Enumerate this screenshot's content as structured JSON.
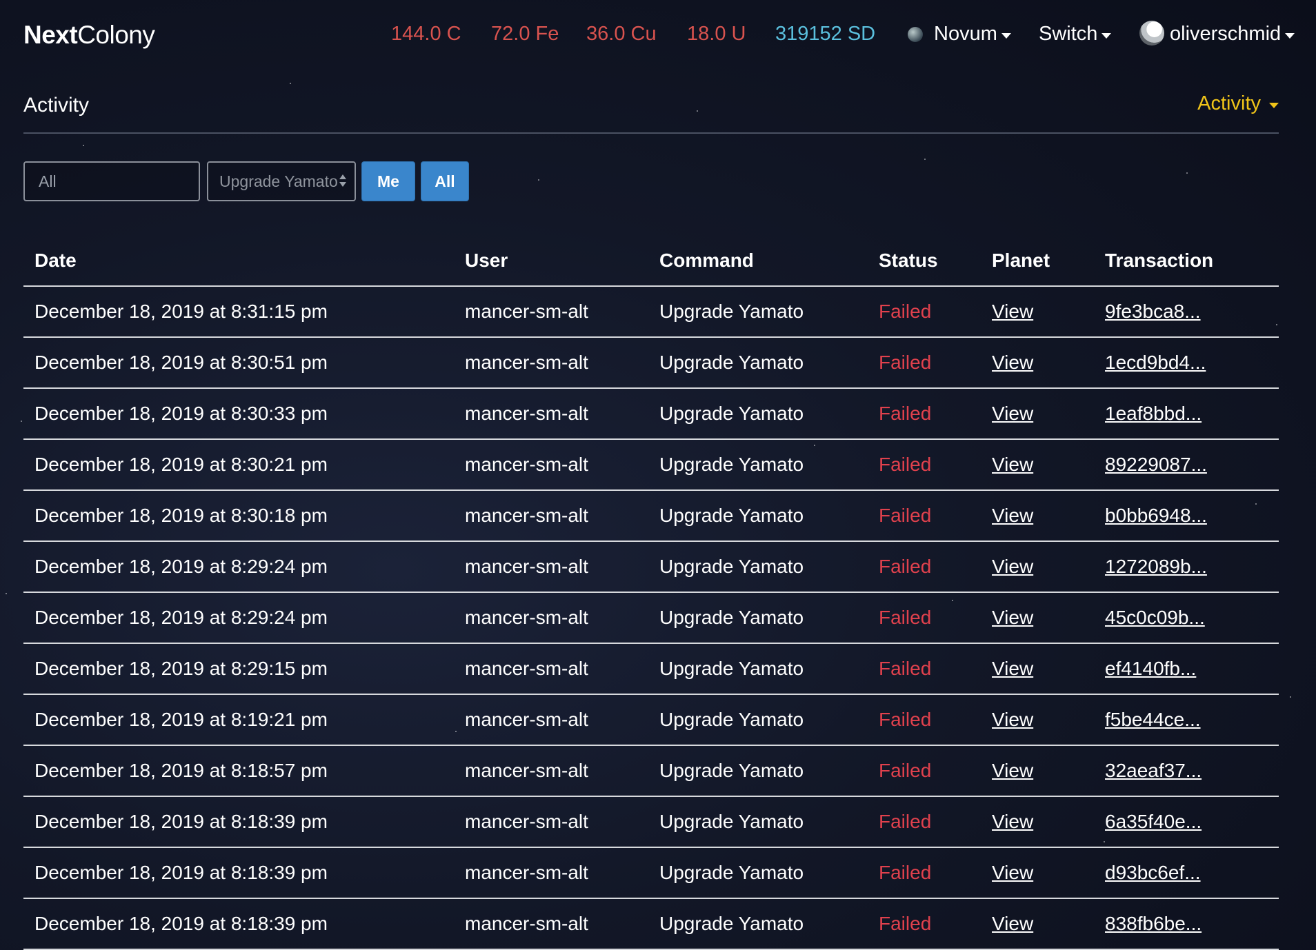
{
  "nav": {
    "brand_bold": "Next",
    "brand_light": "Colony",
    "resources": [
      {
        "label": "144.0 C",
        "color": "#d9534f"
      },
      {
        "label": "72.0 Fe",
        "color": "#d9534f"
      },
      {
        "label": "36.0 Cu",
        "color": "#d9534f"
      },
      {
        "label": "18.0 U",
        "color": "#d9534f"
      },
      {
        "label": "319152 SD",
        "color": "#5bc0de"
      }
    ],
    "planet": "Novum",
    "switch": "Switch",
    "user": "oliverschmid"
  },
  "header": {
    "title": "Activity",
    "dropdown": "Activity"
  },
  "filters": {
    "search_value": "All",
    "command_value": "Upgrade Yamato",
    "btn_me": "Me",
    "btn_all": "All"
  },
  "table": {
    "columns": {
      "date": "Date",
      "user": "User",
      "command": "Command",
      "status": "Status",
      "planet": "Planet",
      "transaction": "Transaction"
    },
    "rows": [
      {
        "date": "December 18, 2019 at 8:31:15 pm",
        "user": "mancer-sm-alt",
        "command": "Upgrade Yamato",
        "status": "Failed",
        "planet": "View",
        "tx": "9fe3bca8..."
      },
      {
        "date": "December 18, 2019 at 8:30:51 pm",
        "user": "mancer-sm-alt",
        "command": "Upgrade Yamato",
        "status": "Failed",
        "planet": "View",
        "tx": "1ecd9bd4..."
      },
      {
        "date": "December 18, 2019 at 8:30:33 pm",
        "user": "mancer-sm-alt",
        "command": "Upgrade Yamato",
        "status": "Failed",
        "planet": "View",
        "tx": "1eaf8bbd..."
      },
      {
        "date": "December 18, 2019 at 8:30:21 pm",
        "user": "mancer-sm-alt",
        "command": "Upgrade Yamato",
        "status": "Failed",
        "planet": "View",
        "tx": "89229087..."
      },
      {
        "date": "December 18, 2019 at 8:30:18 pm",
        "user": "mancer-sm-alt",
        "command": "Upgrade Yamato",
        "status": "Failed",
        "planet": "View",
        "tx": "b0bb6948..."
      },
      {
        "date": "December 18, 2019 at 8:29:24 pm",
        "user": "mancer-sm-alt",
        "command": "Upgrade Yamato",
        "status": "Failed",
        "planet": "View",
        "tx": "1272089b..."
      },
      {
        "date": "December 18, 2019 at 8:29:24 pm",
        "user": "mancer-sm-alt",
        "command": "Upgrade Yamato",
        "status": "Failed",
        "planet": "View",
        "tx": "45c0c09b..."
      },
      {
        "date": "December 18, 2019 at 8:29:15 pm",
        "user": "mancer-sm-alt",
        "command": "Upgrade Yamato",
        "status": "Failed",
        "planet": "View",
        "tx": "ef4140fb..."
      },
      {
        "date": "December 18, 2019 at 8:19:21 pm",
        "user": "mancer-sm-alt",
        "command": "Upgrade Yamato",
        "status": "Failed",
        "planet": "View",
        "tx": "f5be44ce..."
      },
      {
        "date": "December 18, 2019 at 8:18:57 pm",
        "user": "mancer-sm-alt",
        "command": "Upgrade Yamato",
        "status": "Failed",
        "planet": "View",
        "tx": "32aeaf37..."
      },
      {
        "date": "December 18, 2019 at 8:18:39 pm",
        "user": "mancer-sm-alt",
        "command": "Upgrade Yamato",
        "status": "Failed",
        "planet": "View",
        "tx": "6a35f40e..."
      },
      {
        "date": "December 18, 2019 at 8:18:39 pm",
        "user": "mancer-sm-alt",
        "command": "Upgrade Yamato",
        "status": "Failed",
        "planet": "View",
        "tx": "d93bc6ef..."
      },
      {
        "date": "December 18, 2019 at 8:18:39 pm",
        "user": "mancer-sm-alt",
        "command": "Upgrade Yamato",
        "status": "Failed",
        "planet": "View",
        "tx": "838fb6be..."
      }
    ]
  }
}
